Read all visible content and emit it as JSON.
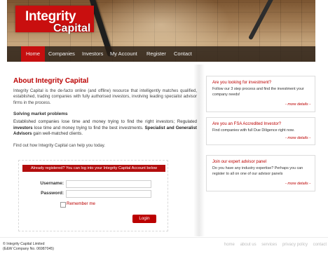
{
  "logo": {
    "line1": "Integrity",
    "line2": "Capital"
  },
  "nav": [
    {
      "label": "Home",
      "active": true
    },
    {
      "label": "Companies",
      "active": false
    },
    {
      "label": "Investors",
      "active": false
    },
    {
      "label": "My Account",
      "active": false
    },
    {
      "label": "Register",
      "active": false
    },
    {
      "label": "Contact",
      "active": false
    }
  ],
  "main": {
    "title": "About Integrity Capital",
    "intro": "Integrity Capital is the de-facto online (and offline) resource that intelligently matches qualified, established, trading companies with fully authorised investors, involving leading specialist advisor firms in the process.",
    "heading": "Solving market problems",
    "para_a": "Established companies lose time and money trying to find the right investors; Regulated ",
    "para_b": "investors",
    "para_c": " lose time and money trying to find the best investments. ",
    "para_d": "Specialist and Generalist Advisors",
    "para_e": " gain well-matched clients.",
    "find_out": "Find out how Integrity Capital can help you today."
  },
  "login": {
    "bar": "Already registered? You can log into your Integrity Capital Account below",
    "username_label": "Username:",
    "password_label": "Password:",
    "remember": "Remember me",
    "button": "Login"
  },
  "panels": [
    {
      "title": "Are you looking for investment?",
      "text": "Follow our 3 step process and find the investment your company needs!",
      "more": "- more details -"
    },
    {
      "title": "Are you an FSA Accredited Investor?",
      "text": "Find companies with full Due Diligence right now.",
      "more": "- more details -"
    },
    {
      "title": "Join our expert advisor panel",
      "text": "Do you have any industry expertise? Perhaps you can register to all on one of our advisor panels",
      "more": "- more details -"
    }
  ],
  "footer": {
    "copyright_1": "© Integrity Capital Limited",
    "copyright_2": "(E&W Company No. 06987045)",
    "links": [
      "home",
      "about us",
      "services",
      "privacy policy",
      "contact"
    ]
  },
  "colors": {
    "accent": "#b00000",
    "nav_bg": "#2a1e16"
  }
}
